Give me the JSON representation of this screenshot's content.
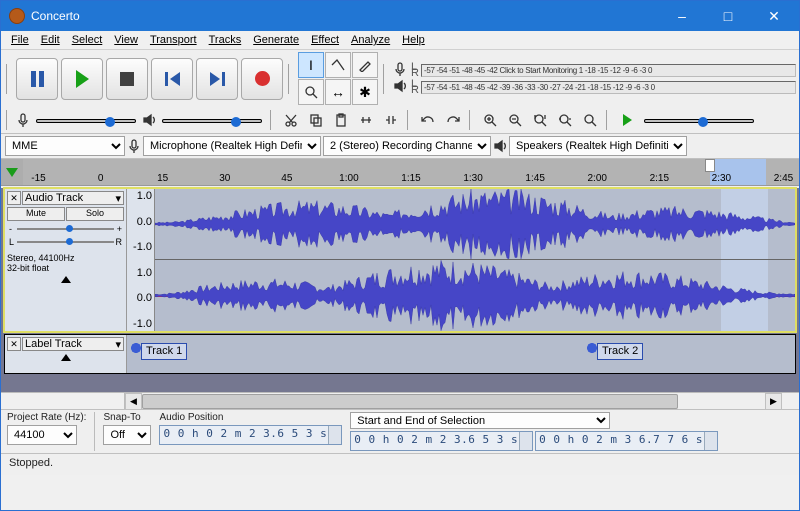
{
  "window": {
    "title": "Concerto"
  },
  "menu": [
    "File",
    "Edit",
    "Select",
    "View",
    "Transport",
    "Tracks",
    "Generate",
    "Effect",
    "Analyze",
    "Help"
  ],
  "meters": {
    "rec_hint": "Click to Start Monitoring",
    "scale_rec": "-57 -54 -51 -48 -45 -42 Click to Start Monitoring 1 -18 -15 -12  -9  -6  -3  0",
    "scale_play": "-57 -54 -51 -48 -45 -42 -39 -36 -33 -30 -27 -24 -21 -18 -15 -12  -9  -6  -3  0"
  },
  "device": {
    "host_label": "MME",
    "input_label": "Microphone (Realtek High Defini",
    "channels_label": "2 (Stereo) Recording Channels",
    "output_label": "Speakers (Realtek High Definiti"
  },
  "ruler": {
    "ticks": [
      "-15",
      "0",
      "15",
      "30",
      "45",
      "1:00",
      "1:15",
      "1:30",
      "1:45",
      "2:00",
      "2:15",
      "2:30",
      "2:45"
    ],
    "play_label": "2:30"
  },
  "audio_track": {
    "name": "Audio Track",
    "mute": "Mute",
    "solo": "Solo",
    "gain_minus": "-",
    "gain_plus": "+",
    "pan_l": "L",
    "pan_r": "R",
    "format_line1": "Stereo, 44100Hz",
    "format_line2": "32-bit float",
    "vscale": [
      "1.0",
      "0.0",
      "-1.0"
    ]
  },
  "label_track": {
    "name": "Label Track",
    "labels": [
      "Track 1",
      "Track 2"
    ]
  },
  "selection": {
    "rate_label": "Project Rate (Hz):",
    "rate_value": "44100",
    "snap_label": "Snap-To",
    "snap_value": "Off",
    "pos_label": "Audio Position",
    "pos_value": "0 0 h 0 2 m 2 3.6 5 3 s",
    "range_label": "Start and End of Selection",
    "start_value": "0 0 h 0 2 m 2 3.6 5 3 s",
    "end_value": "0 0 h 0 2 m 3 6.7 7 6 s"
  },
  "status": {
    "text": "Stopped."
  }
}
